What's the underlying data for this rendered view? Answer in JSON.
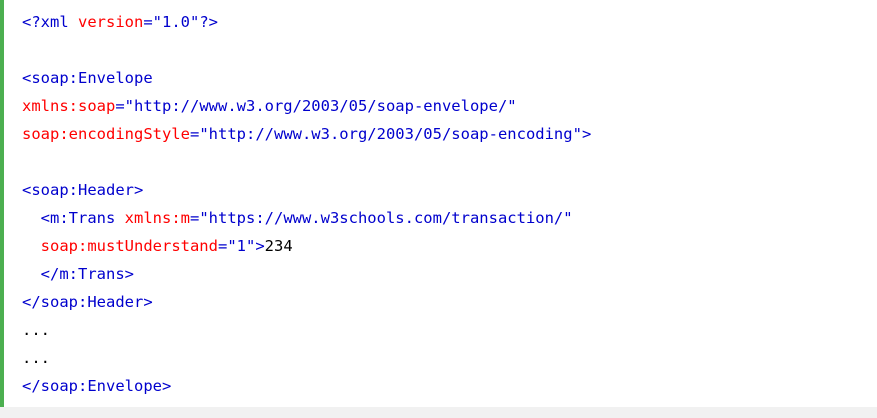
{
  "code_lines": [
    [
      {
        "t": "<?xml",
        "c": "tag"
      },
      {
        "t": " version",
        "c": "attr"
      },
      {
        "t": "=",
        "c": "val"
      },
      {
        "t": "\"1.0\"",
        "c": "val"
      },
      {
        "t": "?>",
        "c": "tag"
      }
    ],
    [],
    [
      {
        "t": "<soap:Envelope",
        "c": "tag"
      }
    ],
    [
      {
        "t": "xmlns:soap",
        "c": "attr"
      },
      {
        "t": "=",
        "c": "val"
      },
      {
        "t": "\"http://www.w3.org/2003/05/soap-envelope/\"",
        "c": "val"
      }
    ],
    [
      {
        "t": "soap:encodingStyle",
        "c": "attr"
      },
      {
        "t": "=",
        "c": "val"
      },
      {
        "t": "\"http://www.w3.org/2003/05/soap-encoding\"",
        "c": "val"
      },
      {
        "t": ">",
        "c": "tag"
      }
    ],
    [],
    [
      {
        "t": "<soap:Header>",
        "c": "tag"
      }
    ],
    [
      {
        "t": "  ",
        "c": "txt"
      },
      {
        "t": "<m:Trans",
        "c": "tag"
      },
      {
        "t": " xmlns:m",
        "c": "attr"
      },
      {
        "t": "=",
        "c": "val"
      },
      {
        "t": "\"https://www.w3schools.com/transaction/\"",
        "c": "val"
      }
    ],
    [
      {
        "t": "  ",
        "c": "txt"
      },
      {
        "t": "soap:mustUnderstand",
        "c": "attr"
      },
      {
        "t": "=",
        "c": "val"
      },
      {
        "t": "\"1\"",
        "c": "val"
      },
      {
        "t": ">",
        "c": "tag"
      },
      {
        "t": "234",
        "c": "txt"
      }
    ],
    [
      {
        "t": "  ",
        "c": "txt"
      },
      {
        "t": "</m:Trans>",
        "c": "tag"
      }
    ],
    [
      {
        "t": "</soap:Header>",
        "c": "tag"
      }
    ],
    [
      {
        "t": "...",
        "c": "txt"
      }
    ],
    [
      {
        "t": "...",
        "c": "txt"
      }
    ],
    [
      {
        "t": "</soap:Envelope>",
        "c": "tag"
      }
    ]
  ],
  "colors": {
    "tag": "#0000cd",
    "attribute": "#ff0000",
    "value": "#0000cd",
    "text": "#000000",
    "accent_border": "#4caf50"
  }
}
